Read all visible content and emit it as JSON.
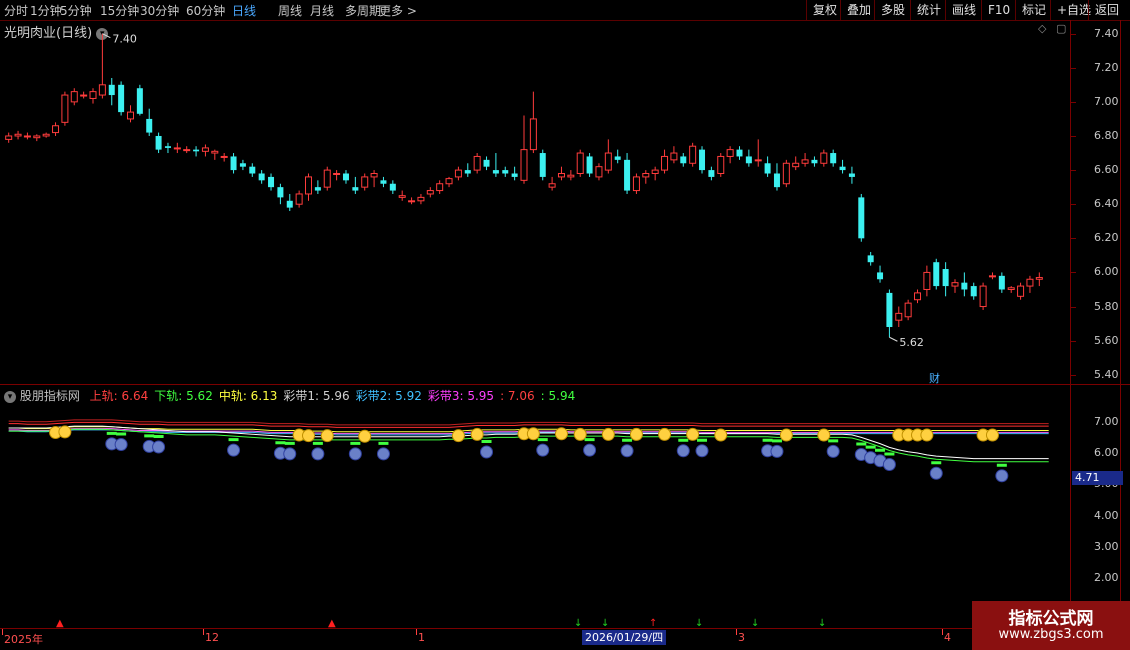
{
  "toolbar": {
    "periods": [
      "分时",
      "1分钟",
      "5分钟",
      "15分钟",
      "30分钟",
      "60分钟",
      "日线",
      "周线",
      "月线",
      "多周期",
      "更多 >"
    ],
    "active_period": "日线",
    "buttons": [
      "复权",
      "叠加",
      "多股",
      "统计",
      "画线",
      "F10",
      "标记",
      "+自选",
      "返回"
    ]
  },
  "stock": {
    "title": "光明肉业(日线)",
    "high_label": "7.40",
    "low_label": "5.62",
    "fin_marker": "财"
  },
  "price_axis": [
    "7.40",
    "7.20",
    "7.00",
    "6.80",
    "6.60",
    "6.40",
    "6.20",
    "6.00",
    "5.80",
    "5.60",
    "5.40"
  ],
  "indicator": {
    "name": "股朋指标网",
    "items": [
      {
        "label": "上轨: 6.64",
        "color": "#ff4040"
      },
      {
        "label": "下轨: 5.62",
        "color": "#40ff40"
      },
      {
        "label": "中轨: 6.13",
        "color": "#ffff40"
      },
      {
        "label": "彩带1: 5.96",
        "color": "#d0d0d0"
      },
      {
        "label": "彩带2: 5.92",
        "color": "#40c0ff"
      },
      {
        "label": "彩带3: 5.95",
        "color": "#ff40ff"
      },
      {
        "label": ": 7.06",
        "color": "#ff4040"
      },
      {
        "label": ": 5.94",
        "color": "#40ff40"
      }
    ],
    "axis": [
      "7.00",
      "6.00",
      "5.00",
      "4.00",
      "3.00",
      "2.00",
      "1.00"
    ],
    "cursor_value": "4.71"
  },
  "time_axis": {
    "labels": [
      "2025年",
      "12",
      "1",
      "3",
      "4"
    ],
    "selected_date": "2026/01/29/四"
  },
  "watermark": {
    "line1": "指标公式网",
    "line2": "www.zbgs3.com"
  },
  "chart_data": {
    "type": "candlestick",
    "ohlc": [
      [
        6.78,
        6.82,
        6.76,
        6.8
      ],
      [
        6.8,
        6.83,
        6.78,
        6.81
      ],
      [
        6.8,
        6.82,
        6.78,
        6.8
      ],
      [
        6.79,
        6.81,
        6.77,
        6.8
      ],
      [
        6.8,
        6.82,
        6.79,
        6.81
      ],
      [
        6.82,
        6.88,
        6.8,
        6.86
      ],
      [
        6.88,
        7.06,
        6.86,
        7.04
      ],
      [
        7.0,
        7.08,
        6.98,
        7.06
      ],
      [
        7.04,
        7.06,
        7.02,
        7.04
      ],
      [
        7.02,
        7.08,
        6.99,
        7.06
      ],
      [
        7.04,
        7.4,
        7.02,
        7.1
      ],
      [
        7.1,
        7.14,
        6.98,
        7.04
      ],
      [
        7.1,
        7.12,
        6.92,
        6.94
      ],
      [
        6.9,
        6.98,
        6.88,
        6.94
      ],
      [
        7.08,
        7.1,
        6.92,
        6.93
      ],
      [
        6.9,
        6.96,
        6.8,
        6.82
      ],
      [
        6.8,
        6.82,
        6.7,
        6.72
      ],
      [
        6.74,
        6.76,
        6.7,
        6.73
      ],
      [
        6.73,
        6.76,
        6.7,
        6.73
      ],
      [
        6.72,
        6.74,
        6.7,
        6.72
      ],
      [
        6.72,
        6.74,
        6.68,
        6.71
      ],
      [
        6.71,
        6.75,
        6.68,
        6.73
      ],
      [
        6.7,
        6.72,
        6.66,
        6.71
      ],
      [
        6.68,
        6.7,
        6.65,
        6.68
      ],
      [
        6.68,
        6.7,
        6.58,
        6.6
      ],
      [
        6.64,
        6.66,
        6.6,
        6.62
      ],
      [
        6.62,
        6.64,
        6.56,
        6.58
      ],
      [
        6.58,
        6.6,
        6.52,
        6.54
      ],
      [
        6.56,
        6.58,
        6.48,
        6.5
      ],
      [
        6.5,
        6.52,
        6.4,
        6.44
      ],
      [
        6.42,
        6.46,
        6.36,
        6.38
      ],
      [
        6.4,
        6.48,
        6.38,
        6.46
      ],
      [
        6.46,
        6.58,
        6.42,
        6.56
      ],
      [
        6.5,
        6.54,
        6.46,
        6.48
      ],
      [
        6.5,
        6.62,
        6.48,
        6.6
      ],
      [
        6.58,
        6.6,
        6.54,
        6.58
      ],
      [
        6.58,
        6.6,
        6.52,
        6.54
      ],
      [
        6.5,
        6.56,
        6.46,
        6.48
      ],
      [
        6.5,
        6.58,
        6.48,
        6.56
      ],
      [
        6.56,
        6.6,
        6.5,
        6.58
      ],
      [
        6.54,
        6.56,
        6.5,
        6.52
      ],
      [
        6.52,
        6.54,
        6.46,
        6.48
      ],
      [
        6.44,
        6.48,
        6.42,
        6.45
      ],
      [
        6.42,
        6.44,
        6.4,
        6.42
      ],
      [
        6.42,
        6.46,
        6.4,
        6.44
      ],
      [
        6.46,
        6.5,
        6.44,
        6.48
      ],
      [
        6.48,
        6.54,
        6.46,
        6.52
      ],
      [
        6.52,
        6.56,
        6.5,
        6.55
      ],
      [
        6.56,
        6.62,
        6.54,
        6.6
      ],
      [
        6.6,
        6.64,
        6.56,
        6.58
      ],
      [
        6.6,
        6.7,
        6.58,
        6.68
      ],
      [
        6.66,
        6.68,
        6.6,
        6.62
      ],
      [
        6.6,
        6.7,
        6.56,
        6.58
      ],
      [
        6.6,
        6.62,
        6.56,
        6.58
      ],
      [
        6.58,
        6.62,
        6.54,
        6.56
      ],
      [
        6.54,
        6.92,
        6.52,
        6.72
      ],
      [
        6.72,
        7.06,
        6.7,
        6.9
      ],
      [
        6.7,
        6.72,
        6.54,
        6.56
      ],
      [
        6.5,
        6.56,
        6.48,
        6.52
      ],
      [
        6.56,
        6.62,
        6.54,
        6.58
      ],
      [
        6.56,
        6.6,
        6.54,
        6.57
      ],
      [
        6.58,
        6.72,
        6.56,
        6.7
      ],
      [
        6.68,
        6.7,
        6.56,
        6.58
      ],
      [
        6.56,
        6.64,
        6.54,
        6.62
      ],
      [
        6.6,
        6.78,
        6.58,
        6.7
      ],
      [
        6.68,
        6.72,
        6.64,
        6.66
      ],
      [
        6.66,
        6.7,
        6.46,
        6.48
      ],
      [
        6.48,
        6.58,
        6.46,
        6.56
      ],
      [
        6.56,
        6.6,
        6.52,
        6.58
      ],
      [
        6.58,
        6.62,
        6.54,
        6.6
      ],
      [
        6.6,
        6.72,
        6.58,
        6.68
      ],
      [
        6.66,
        6.74,
        6.64,
        6.7
      ],
      [
        6.68,
        6.7,
        6.62,
        6.64
      ],
      [
        6.64,
        6.76,
        6.62,
        6.74
      ],
      [
        6.72,
        6.74,
        6.58,
        6.6
      ],
      [
        6.6,
        6.62,
        6.54,
        6.56
      ],
      [
        6.58,
        6.7,
        6.56,
        6.68
      ],
      [
        6.68,
        6.74,
        6.64,
        6.72
      ],
      [
        6.72,
        6.74,
        6.66,
        6.68
      ],
      [
        6.68,
        6.72,
        6.62,
        6.64
      ],
      [
        6.66,
        6.78,
        6.62,
        6.66
      ],
      [
        6.64,
        6.68,
        6.56,
        6.58
      ],
      [
        6.58,
        6.64,
        6.48,
        6.5
      ],
      [
        6.52,
        6.66,
        6.5,
        6.64
      ],
      [
        6.62,
        6.68,
        6.6,
        6.64
      ],
      [
        6.64,
        6.7,
        6.62,
        6.66
      ],
      [
        6.66,
        6.68,
        6.62,
        6.64
      ],
      [
        6.64,
        6.72,
        6.62,
        6.7
      ],
      [
        6.7,
        6.72,
        6.62,
        6.64
      ],
      [
        6.62,
        6.66,
        6.58,
        6.6
      ],
      [
        6.58,
        6.62,
        6.52,
        6.56
      ],
      [
        6.44,
        6.46,
        6.18,
        6.2
      ],
      [
        6.1,
        6.12,
        6.04,
        6.06
      ],
      [
        6.0,
        6.04,
        5.94,
        5.96
      ],
      [
        5.88,
        5.9,
        5.62,
        5.68
      ],
      [
        5.72,
        5.8,
        5.68,
        5.76
      ],
      [
        5.74,
        5.84,
        5.72,
        5.82
      ],
      [
        5.84,
        5.9,
        5.82,
        5.88
      ],
      [
        5.9,
        6.04,
        5.86,
        6.0
      ],
      [
        6.06,
        6.08,
        5.9,
        5.92
      ],
      [
        6.02,
        6.06,
        5.86,
        5.92
      ],
      [
        5.92,
        5.96,
        5.88,
        5.94
      ],
      [
        5.94,
        6.0,
        5.86,
        5.9
      ],
      [
        5.92,
        5.94,
        5.84,
        5.86
      ],
      [
        5.8,
        5.94,
        5.78,
        5.92
      ],
      [
        5.98,
        6.0,
        5.96,
        5.98
      ],
      [
        5.98,
        6.0,
        5.88,
        5.9
      ],
      [
        5.9,
        5.92,
        5.88,
        5.91
      ],
      [
        5.86,
        5.94,
        5.84,
        5.92
      ],
      [
        5.92,
        5.98,
        5.88,
        5.96
      ],
      [
        5.96,
        6.0,
        5.92,
        5.97
      ]
    ],
    "price_range": [
      5.34,
      7.48
    ],
    "indicator_lines": {
      "upper": [
        7.02,
        7.02,
        7.0,
        7.0,
        7.0,
        7.02,
        7.04,
        7.06,
        7.06,
        7.06,
        7.06,
        7.06,
        7.04,
        7.02,
        7.0,
        7.0,
        7.0,
        6.98,
        6.98,
        6.98,
        6.98,
        6.98,
        6.98,
        6.98,
        6.98,
        6.98,
        6.98,
        6.96,
        6.94,
        6.94,
        6.94,
        6.94,
        6.92,
        6.92,
        6.92,
        6.9,
        6.9,
        6.9,
        6.9,
        6.9,
        6.9,
        6.9,
        6.9,
        6.9,
        6.9,
        6.9,
        6.9,
        6.9,
        6.92,
        6.94,
        6.96,
        6.96,
        6.96,
        6.96,
        6.96,
        6.98,
        6.98,
        6.98,
        6.98,
        6.98,
        6.96,
        6.96,
        6.96,
        6.96,
        6.96,
        6.96,
        6.96,
        6.96,
        6.96,
        6.96,
        6.96,
        6.96,
        6.96,
        6.96,
        6.94,
        6.94,
        6.94,
        6.94,
        6.94,
        6.94,
        6.94,
        6.94,
        6.94,
        6.94,
        6.94,
        6.94,
        6.94,
        6.94,
        6.94,
        6.94,
        6.94,
        6.94,
        6.94,
        6.94,
        6.94,
        6.94,
        6.94,
        6.94,
        6.94,
        6.94,
        6.94,
        6.94,
        6.94,
        6.94,
        6.94,
        6.94,
        6.94,
        6.94,
        6.94,
        6.94,
        6.94,
        6.94
      ],
      "lower": [
        6.7,
        6.7,
        6.7,
        6.7,
        6.7,
        6.72,
        6.74,
        6.76,
        6.76,
        6.76,
        6.76,
        6.74,
        6.72,
        6.7,
        6.68,
        6.66,
        6.64,
        6.62,
        6.6,
        6.58,
        6.58,
        6.58,
        6.58,
        6.56,
        6.54,
        6.52,
        6.5,
        6.48,
        6.46,
        6.44,
        6.42,
        6.42,
        6.42,
        6.42,
        6.42,
        6.42,
        6.42,
        6.42,
        6.42,
        6.42,
        6.42,
        6.42,
        6.42,
        6.42,
        6.42,
        6.42,
        6.42,
        6.44,
        6.44,
        6.46,
        6.48,
        6.48,
        6.5,
        6.5,
        6.5,
        6.52,
        6.54,
        6.54,
        6.54,
        6.54,
        6.54,
        6.54,
        6.54,
        6.54,
        6.54,
        6.54,
        6.52,
        6.52,
        6.52,
        6.52,
        6.52,
        6.52,
        6.52,
        6.52,
        6.52,
        6.52,
        6.52,
        6.52,
        6.52,
        6.52,
        6.52,
        6.52,
        6.5,
        6.5,
        6.5,
        6.5,
        6.5,
        6.5,
        6.5,
        6.5,
        6.48,
        6.4,
        6.3,
        6.2,
        6.08,
        6.0,
        5.94,
        5.9,
        5.84,
        5.8,
        5.78,
        5.76,
        5.74,
        5.72,
        5.72,
        5.72,
        5.72,
        5.72,
        5.72,
        5.72,
        5.72,
        5.72
      ]
    }
  }
}
